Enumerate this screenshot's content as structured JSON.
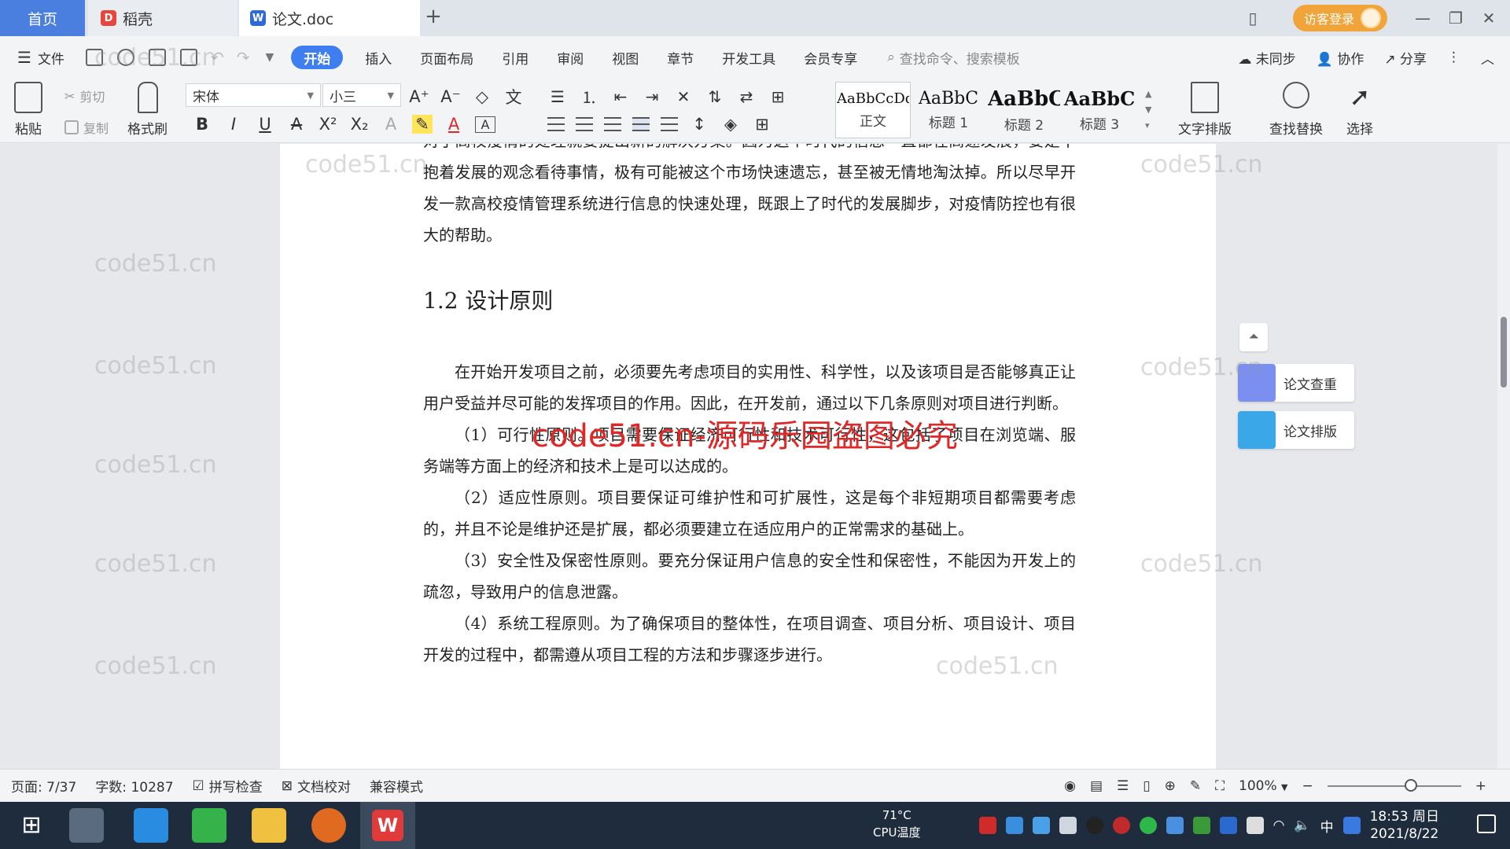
{
  "tabs": {
    "home": "首页",
    "daoke": "稻壳",
    "doc": "论文.doc",
    "new_tab": "+",
    "close": "✕"
  },
  "window": {
    "login": "访客登录"
  },
  "menu": {
    "file": "文件",
    "items": [
      "开始",
      "插入",
      "页面布局",
      "引用",
      "审阅",
      "视图",
      "章节",
      "开发工具",
      "会员专享"
    ],
    "search_placeholder": "查找命令、搜索模板",
    "sync": "未同步",
    "collab": "协作",
    "share": "分享"
  },
  "ribbon": {
    "paste": "粘贴",
    "cut": "剪切",
    "copy": "复制",
    "format_painter": "格式刷",
    "font": "宋体",
    "font_size": "小三",
    "styles": [
      {
        "sample": "AaBbCcDd",
        "name": "正文"
      },
      {
        "sample": "AaBbC",
        "name": "标题 1"
      },
      {
        "sample": "AaBbC",
        "name": "标题 2"
      },
      {
        "sample": "AaBbC",
        "name": "标题 3"
      }
    ],
    "text_layout": "文字排版",
    "find_replace": "查找替换",
    "select": "选择"
  },
  "document": {
    "intro_lines": "对于高校疫情的处理就要提出新的解决方案。因为这个时代的信息一直都在高速发展，要是不抱着发展的观念看待事情，极有可能被这个市场快速遗忘，甚至被无情地淘汰掉。所以尽早开发一款高校疫情管理系统进行信息的快速处理，既跟上了时代的发展脚步，对疫情防控也有很大的帮助。",
    "heading": "1.2 设计原则",
    "para1": "在开始开发项目之前，必须要先考虑项目的实用性、科学性，以及该项目是否能够真正让用户受益并尽可能的发挥项目的作用。因此，在开发前，通过以下几条原则对项目进行判断。",
    "p_feasibility": "（1）可行性原则。项目需要保证经济可行性和技术可行性，这包括了项目在浏览端、服务端等方面上的经济和技术上是可以达成的。",
    "p_adaptability": "（2）适应性原则。项目要保证可维护性和可扩展性，这是每个非短期项目都需要考虑的，并且不论是维护还是扩展，都必须要建立在适应用户的正常需求的基础上。",
    "p_security": "（3）安全性及保密性原则。要充分保证用户信息的安全性和保密性，不能因为开发上的疏忽，导致用户的信息泄露。",
    "p_system": "（4）系统工程原则。为了确保项目的整体性，在项目调查、项目分析、项目设计、项目开发的过程中，都需遵从项目工程的方法和步骤逐步进行。",
    "watermark": "code51.cn-源码乐园盗图必究",
    "tile": "code51.cn"
  },
  "side_panel": {
    "check": "论文查重",
    "layout": "论文排版"
  },
  "status": {
    "page": "页面: 7/37",
    "words": "字数: 10287",
    "spell": "拼写检查",
    "proof": "文档校对",
    "compat": "兼容模式",
    "zoom": "100%"
  },
  "taskbar": {
    "temp": "71°C",
    "temp_label": "CPU温度",
    "ime": "中",
    "time": "18:53 周日",
    "date": "2021/8/22"
  },
  "colors": {
    "accent": "#3f7ef0",
    "watermark_red": "#e02828",
    "login_orange": "#f0a43a"
  }
}
